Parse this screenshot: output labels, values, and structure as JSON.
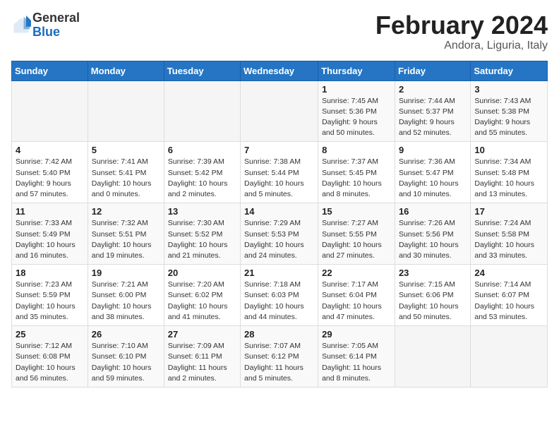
{
  "header": {
    "logo_general": "General",
    "logo_blue": "Blue",
    "month_year": "February 2024",
    "subtitle": "Andora, Liguria, Italy"
  },
  "days_of_week": [
    "Sunday",
    "Monday",
    "Tuesday",
    "Wednesday",
    "Thursday",
    "Friday",
    "Saturday"
  ],
  "weeks": [
    [
      {
        "day": "",
        "info": ""
      },
      {
        "day": "",
        "info": ""
      },
      {
        "day": "",
        "info": ""
      },
      {
        "day": "",
        "info": ""
      },
      {
        "day": "1",
        "info": "Sunrise: 7:45 AM\nSunset: 5:36 PM\nDaylight: 9 hours\nand 50 minutes."
      },
      {
        "day": "2",
        "info": "Sunrise: 7:44 AM\nSunset: 5:37 PM\nDaylight: 9 hours\nand 52 minutes."
      },
      {
        "day": "3",
        "info": "Sunrise: 7:43 AM\nSunset: 5:38 PM\nDaylight: 9 hours\nand 55 minutes."
      }
    ],
    [
      {
        "day": "4",
        "info": "Sunrise: 7:42 AM\nSunset: 5:40 PM\nDaylight: 9 hours\nand 57 minutes."
      },
      {
        "day": "5",
        "info": "Sunrise: 7:41 AM\nSunset: 5:41 PM\nDaylight: 10 hours\nand 0 minutes."
      },
      {
        "day": "6",
        "info": "Sunrise: 7:39 AM\nSunset: 5:42 PM\nDaylight: 10 hours\nand 2 minutes."
      },
      {
        "day": "7",
        "info": "Sunrise: 7:38 AM\nSunset: 5:44 PM\nDaylight: 10 hours\nand 5 minutes."
      },
      {
        "day": "8",
        "info": "Sunrise: 7:37 AM\nSunset: 5:45 PM\nDaylight: 10 hours\nand 8 minutes."
      },
      {
        "day": "9",
        "info": "Sunrise: 7:36 AM\nSunset: 5:47 PM\nDaylight: 10 hours\nand 10 minutes."
      },
      {
        "day": "10",
        "info": "Sunrise: 7:34 AM\nSunset: 5:48 PM\nDaylight: 10 hours\nand 13 minutes."
      }
    ],
    [
      {
        "day": "11",
        "info": "Sunrise: 7:33 AM\nSunset: 5:49 PM\nDaylight: 10 hours\nand 16 minutes."
      },
      {
        "day": "12",
        "info": "Sunrise: 7:32 AM\nSunset: 5:51 PM\nDaylight: 10 hours\nand 19 minutes."
      },
      {
        "day": "13",
        "info": "Sunrise: 7:30 AM\nSunset: 5:52 PM\nDaylight: 10 hours\nand 21 minutes."
      },
      {
        "day": "14",
        "info": "Sunrise: 7:29 AM\nSunset: 5:53 PM\nDaylight: 10 hours\nand 24 minutes."
      },
      {
        "day": "15",
        "info": "Sunrise: 7:27 AM\nSunset: 5:55 PM\nDaylight: 10 hours\nand 27 minutes."
      },
      {
        "day": "16",
        "info": "Sunrise: 7:26 AM\nSunset: 5:56 PM\nDaylight: 10 hours\nand 30 minutes."
      },
      {
        "day": "17",
        "info": "Sunrise: 7:24 AM\nSunset: 5:58 PM\nDaylight: 10 hours\nand 33 minutes."
      }
    ],
    [
      {
        "day": "18",
        "info": "Sunrise: 7:23 AM\nSunset: 5:59 PM\nDaylight: 10 hours\nand 35 minutes."
      },
      {
        "day": "19",
        "info": "Sunrise: 7:21 AM\nSunset: 6:00 PM\nDaylight: 10 hours\nand 38 minutes."
      },
      {
        "day": "20",
        "info": "Sunrise: 7:20 AM\nSunset: 6:02 PM\nDaylight: 10 hours\nand 41 minutes."
      },
      {
        "day": "21",
        "info": "Sunrise: 7:18 AM\nSunset: 6:03 PM\nDaylight: 10 hours\nand 44 minutes."
      },
      {
        "day": "22",
        "info": "Sunrise: 7:17 AM\nSunset: 6:04 PM\nDaylight: 10 hours\nand 47 minutes."
      },
      {
        "day": "23",
        "info": "Sunrise: 7:15 AM\nSunset: 6:06 PM\nDaylight: 10 hours\nand 50 minutes."
      },
      {
        "day": "24",
        "info": "Sunrise: 7:14 AM\nSunset: 6:07 PM\nDaylight: 10 hours\nand 53 minutes."
      }
    ],
    [
      {
        "day": "25",
        "info": "Sunrise: 7:12 AM\nSunset: 6:08 PM\nDaylight: 10 hours\nand 56 minutes."
      },
      {
        "day": "26",
        "info": "Sunrise: 7:10 AM\nSunset: 6:10 PM\nDaylight: 10 hours\nand 59 minutes."
      },
      {
        "day": "27",
        "info": "Sunrise: 7:09 AM\nSunset: 6:11 PM\nDaylight: 11 hours\nand 2 minutes."
      },
      {
        "day": "28",
        "info": "Sunrise: 7:07 AM\nSunset: 6:12 PM\nDaylight: 11 hours\nand 5 minutes."
      },
      {
        "day": "29",
        "info": "Sunrise: 7:05 AM\nSunset: 6:14 PM\nDaylight: 11 hours\nand 8 minutes."
      },
      {
        "day": "",
        "info": ""
      },
      {
        "day": "",
        "info": ""
      }
    ]
  ]
}
